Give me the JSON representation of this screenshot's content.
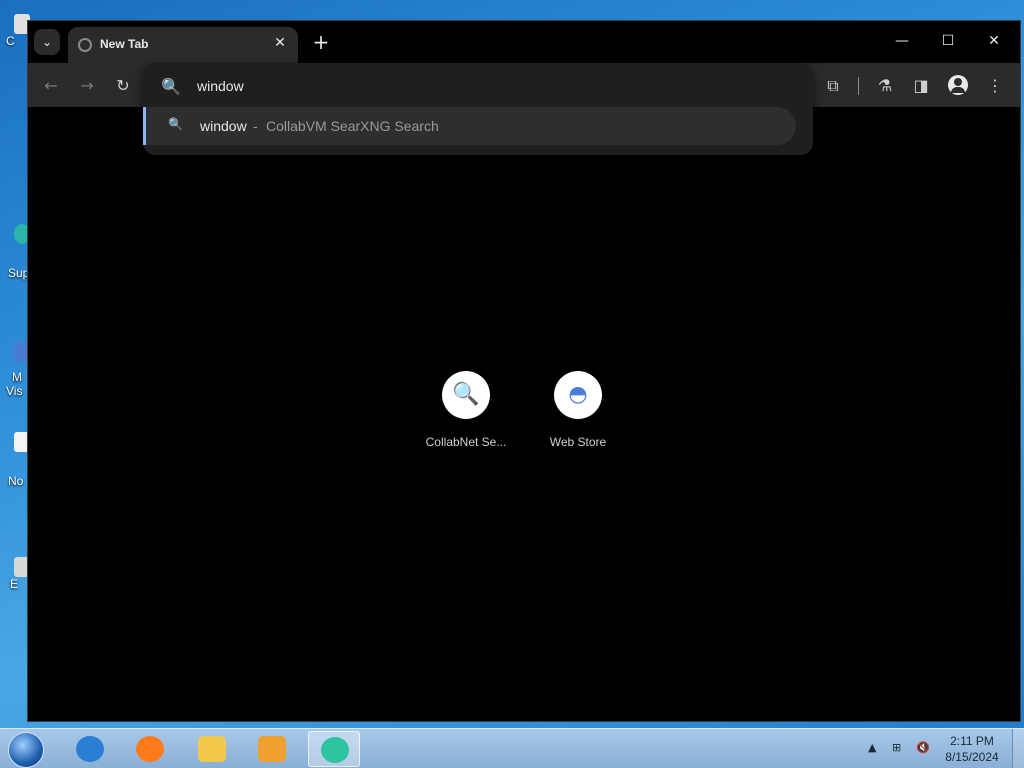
{
  "desktop": {
    "icons": [
      {
        "label": "C",
        "color": "#e0e0e0"
      },
      {
        "label": "Sup",
        "color": "#2bb5a8"
      },
      {
        "label": "M",
        "color": "#4b7bd1"
      },
      {
        "label": "Vis",
        "color": "#4b7bd1"
      },
      {
        "label": "No",
        "color": "#f4f4f4"
      },
      {
        "label": "E",
        "color": "#d8d8d8"
      }
    ]
  },
  "browser": {
    "tab": {
      "title": "New Tab",
      "close_glyph": "✕"
    },
    "tab_search_glyph": "⌄",
    "new_tab_glyph": "+",
    "window_controls": {
      "minimize": "—",
      "maximize": "☐",
      "close": "✕"
    },
    "toolbar": {
      "back": "←",
      "forward": "→",
      "reload": "↻",
      "extensions": "⧉",
      "labs": "⚗",
      "side_panel": "◨",
      "menu": "⋮"
    },
    "omnibox": {
      "search_glyph": "🔍",
      "value": "window",
      "suggestion": {
        "query": "window",
        "separator": "-",
        "description": "CollabVM SearXNG Search",
        "glyph": "🔍"
      }
    },
    "shortcuts": [
      {
        "label": "CollabNet Se...",
        "glyph": "🔍"
      },
      {
        "label": "Web Store",
        "glyph": "◓"
      }
    ]
  },
  "taskbar": {
    "apps": [
      {
        "name": "internet-explorer",
        "color": "#2a7fd4"
      },
      {
        "name": "firefox",
        "color": "#ff7a1a"
      },
      {
        "name": "file-explorer",
        "color": "#f2c94c"
      },
      {
        "name": "media-player",
        "color": "#f0a030"
      },
      {
        "name": "browser-active",
        "color": "#2ec4a0"
      }
    ],
    "tray": {
      "chevron": "▲",
      "network": "⊞",
      "volume": "🔇"
    },
    "clock": {
      "time": "2:11 PM",
      "date": "8/15/2024"
    }
  }
}
